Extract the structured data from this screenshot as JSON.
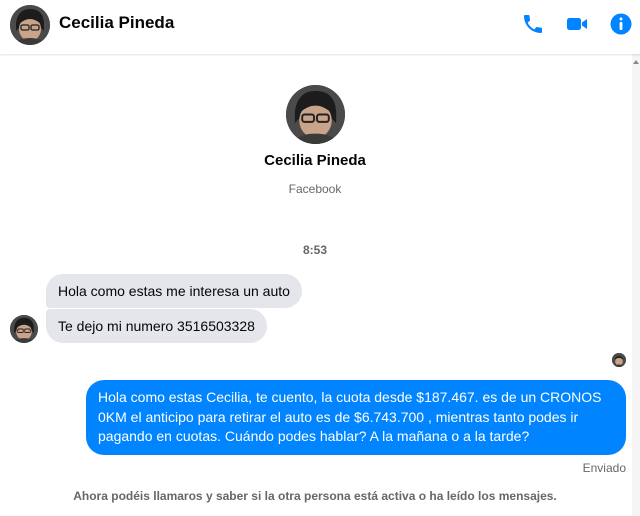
{
  "header": {
    "contact_name": "Cecilia Pineda",
    "icons": [
      "phone-icon",
      "video-camera-icon",
      "info-icon"
    ],
    "accent_color": "#0084ff"
  },
  "profile": {
    "name": "Cecilia Pineda",
    "subtitle": "Facebook"
  },
  "conversation": {
    "timestamp": "8:53",
    "incoming": [
      "Hola como estas me interesa un auto",
      "Te dejo mi numero 3516503328"
    ],
    "outgoing": [
      "Hola como estas Cecilia, te cuento, la cuota desde $187.467. es de un CRONOS 0KM el anticipo para retirar el auto es de $6.743.700 , mientras tanto podes ir pagando en cuotas. Cuándo podes hablar? A la mañana o a la tarde?"
    ],
    "status": "Enviado",
    "notice": "Ahora podéis llamaros y saber si la otra persona está activa o ha leído los mensajes."
  }
}
